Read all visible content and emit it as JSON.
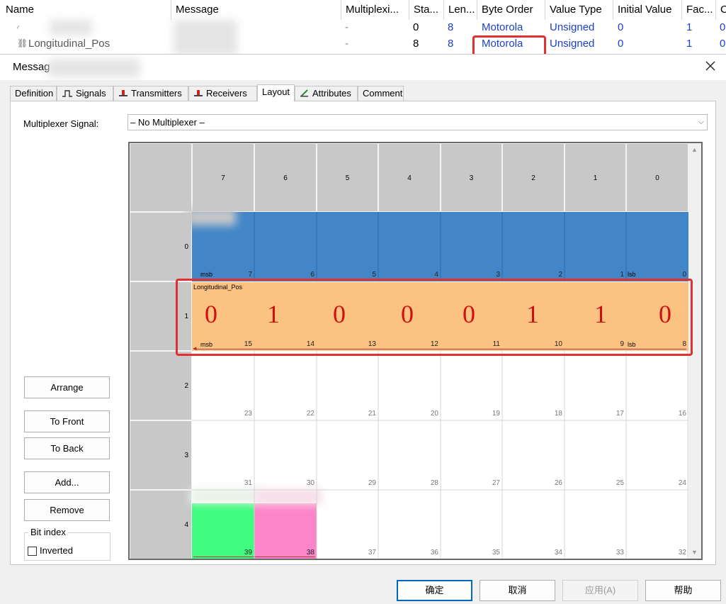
{
  "signal_table": {
    "headers": [
      "Name",
      "Message",
      "Multiplexi...",
      "Sta...",
      "Len...",
      "Byte Order",
      "Value Type",
      "Initial Value",
      "Fac...",
      "C"
    ],
    "rows": [
      {
        "name": "",
        "multiplex": "-",
        "start": "0",
        "length": "8",
        "byte_order": "Motorola",
        "value_type": "Unsigned",
        "initial": "0",
        "factor": "1",
        "offset": "0"
      },
      {
        "name": "Longitudinal_Pos",
        "multiplex": "-",
        "start": "8",
        "length": "8",
        "byte_order": "Motorola",
        "value_type": "Unsigned",
        "initial": "0",
        "factor": "1",
        "offset": "0"
      }
    ]
  },
  "dialog": {
    "title": "Messag",
    "tabs": [
      {
        "label": "Definition",
        "icon": ""
      },
      {
        "label": "Signals",
        "icon": "signals-icon"
      },
      {
        "label": "Transmitters",
        "icon": "transmitter-icon"
      },
      {
        "label": "Receivers",
        "icon": "receiver-icon"
      },
      {
        "label": "Layout",
        "icon": ""
      },
      {
        "label": "Attributes",
        "icon": "attributes-icon"
      },
      {
        "label": "Comment",
        "icon": ""
      }
    ],
    "active_tab": "Layout",
    "multiplexer_label": "Multiplexer Signal:",
    "multiplexer_value": "– No Multiplexer –",
    "layout": {
      "col_headers": [
        "7",
        "6",
        "5",
        "4",
        "3",
        "2",
        "1",
        "0"
      ],
      "row_headers": [
        "0",
        "1",
        "2",
        "3",
        "4"
      ],
      "signal_label": "Longitudinal_Pos",
      "msb_label": "msb",
      "lsb_label": "lsb",
      "bit_values": [
        "0",
        "1",
        "0",
        "0",
        "0",
        "1",
        "1",
        "0"
      ],
      "bit_numbers": [
        [
          "7",
          "6",
          "5",
          "4",
          "3",
          "2",
          "1",
          "0"
        ],
        [
          "15",
          "14",
          "13",
          "12",
          "11",
          "10",
          "9",
          "8"
        ],
        [
          "23",
          "22",
          "21",
          "20",
          "19",
          "18",
          "17",
          "16"
        ],
        [
          "31",
          "30",
          "29",
          "28",
          "27",
          "26",
          "25",
          "24"
        ],
        [
          "39",
          "38",
          "37",
          "36",
          "35",
          "34",
          "33",
          "32"
        ]
      ]
    },
    "side_buttons": {
      "arrange": "Arrange",
      "to_front": "To Front",
      "to_back": "To Back",
      "add": "Add...",
      "remove": "Remove"
    },
    "bit_index": {
      "label": "Bit index",
      "inverted": "Inverted",
      "checked": false
    },
    "bottom_buttons": {
      "ok": "确定",
      "cancel": "取消",
      "apply": "应用(A)",
      "help": "帮助"
    }
  },
  "colors": {
    "signal_blue": "#4286c8",
    "signal_orange": "#fcc282",
    "signal_green": "#40fc80",
    "signal_pink": "#fc84c8",
    "annotation_red": "#e03030",
    "link_blue": "#1a3fcc"
  }
}
